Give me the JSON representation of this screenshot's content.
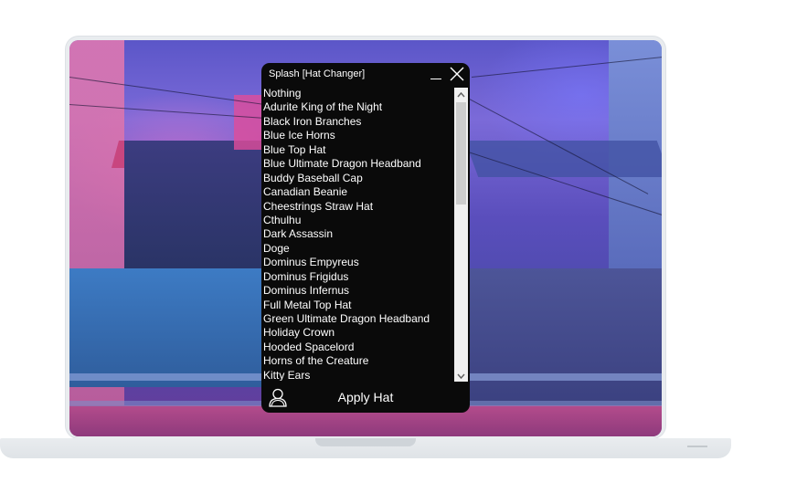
{
  "window": {
    "title": "Splash [Hat Changer]",
    "minimize_icon": "minimize-icon",
    "close_icon": "close-icon"
  },
  "hats": [
    "Nothing",
    "Adurite King of the Night",
    "Black Iron Branches",
    "Blue Ice Horns",
    "Blue Top Hat",
    "Blue Ultimate Dragon Headband",
    "Buddy Baseball Cap",
    "Canadian Beanie",
    "Cheestrings Straw Hat",
    "Cthulhu",
    "Dark Assassin",
    "Doge",
    "Dominus Empyreus",
    "Dominus Frigidus",
    "Dominus Infernus",
    "Full Metal Top Hat",
    "Green Ultimate Dragon Headband",
    "Holiday Crown",
    "Hooded Spacelord",
    "Horns of the Creature",
    "Kitty Ears"
  ],
  "footer": {
    "apply_label": "Apply Hat",
    "avatar_icon": "avatar-icon"
  },
  "colors": {
    "window_bg": "#0a0a0a",
    "text": "#ffffff",
    "scrollbar_track": "#f0f0f0",
    "scrollbar_thumb": "#cdcdcd"
  }
}
